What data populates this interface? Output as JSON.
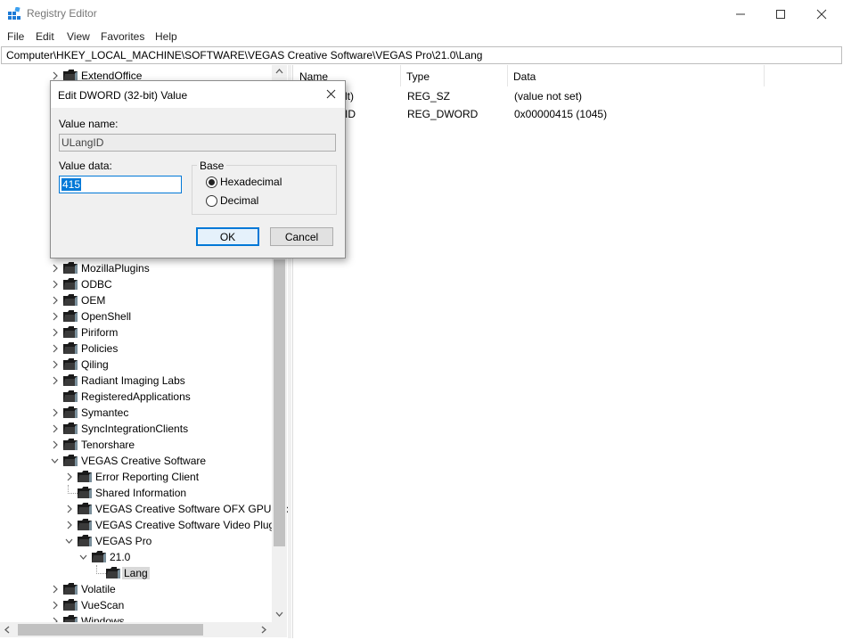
{
  "window": {
    "title": "Registry Editor"
  },
  "menu": [
    "File",
    "Edit",
    "View",
    "Favorites",
    "Help"
  ],
  "address": "Computer\\HKEY_LOCAL_MACHINE\\SOFTWARE\\VEGAS Creative Software\\VEGAS Pro\\21.0\\Lang",
  "tree": {
    "items": [
      {
        "label": "ExtendOffice",
        "level": 1,
        "expander": "collapsed",
        "selected": false
      },
      {
        "label": "MozillaPlugins",
        "level": 1,
        "expander": "collapsed",
        "selected": false
      },
      {
        "label": "ODBC",
        "level": 1,
        "expander": "collapsed",
        "selected": false
      },
      {
        "label": "OEM",
        "level": 1,
        "expander": "collapsed",
        "selected": false
      },
      {
        "label": "OpenShell",
        "level": 1,
        "expander": "collapsed",
        "selected": false
      },
      {
        "label": "Piriform",
        "level": 1,
        "expander": "collapsed",
        "selected": false
      },
      {
        "label": "Policies",
        "level": 1,
        "expander": "collapsed",
        "selected": false
      },
      {
        "label": "Qiling",
        "level": 1,
        "expander": "collapsed",
        "selected": false
      },
      {
        "label": "Radiant Imaging Labs",
        "level": 1,
        "expander": "collapsed",
        "selected": false
      },
      {
        "label": "RegisteredApplications",
        "level": 1,
        "expander": "none",
        "selected": false
      },
      {
        "label": "Symantec",
        "level": 1,
        "expander": "collapsed",
        "selected": false
      },
      {
        "label": "SyncIntegrationClients",
        "level": 1,
        "expander": "collapsed",
        "selected": false
      },
      {
        "label": "Tenorshare",
        "level": 1,
        "expander": "collapsed",
        "selected": false
      },
      {
        "label": "VEGAS Creative Software",
        "level": 1,
        "expander": "expanded",
        "selected": false
      },
      {
        "label": "Error Reporting Client",
        "level": 2,
        "expander": "collapsed",
        "selected": false
      },
      {
        "label": "Shared Information",
        "level": 2,
        "expander": "none",
        "selected": false
      },
      {
        "label": "VEGAS Creative Software OFX GPU Vic",
        "level": 2,
        "expander": "collapsed",
        "selected": false
      },
      {
        "label": "VEGAS Creative Software Video Plug-I",
        "level": 2,
        "expander": "collapsed",
        "selected": false
      },
      {
        "label": "VEGAS Pro",
        "level": 2,
        "expander": "expanded",
        "selected": false
      },
      {
        "label": "21.0",
        "level": 3,
        "expander": "expanded",
        "selected": false
      },
      {
        "label": "Lang",
        "level": 4,
        "expander": "none",
        "selected": true
      },
      {
        "label": "Volatile",
        "level": 1,
        "expander": "collapsed",
        "selected": false
      },
      {
        "label": "VueScan",
        "level": 1,
        "expander": "collapsed",
        "selected": false
      },
      {
        "label": "Windows",
        "level": 1,
        "expander": "collapsed",
        "selected": false
      }
    ]
  },
  "list": {
    "columns": [
      "Name",
      "Type",
      "Data"
    ],
    "rows": [
      {
        "name": "(Default)",
        "name_visible": "lt)",
        "type": "REG_SZ",
        "data": "(value not set)"
      },
      {
        "name": "ULangID",
        "name_visible": "ID",
        "type": "REG_DWORD",
        "data": "0x00000415 (1045)"
      }
    ]
  },
  "dialog": {
    "title": "Edit DWORD (32-bit) Value",
    "value_name_label": "Value name:",
    "value_name": "ULangID",
    "value_data_label": "Value data:",
    "value_data": "415",
    "base_label": "Base",
    "base_options": [
      {
        "label": "Hexadecimal",
        "checked": true
      },
      {
        "label": "Decimal",
        "checked": false
      }
    ],
    "ok_label": "OK",
    "cancel_label": "Cancel"
  },
  "colors": {
    "folder": "#1a1a1a",
    "selection": "#0078d7",
    "dialog_bg": "#f0f0f0"
  },
  "icons": [
    "registry-app-icon",
    "minimize-icon",
    "maximize-icon",
    "close-icon",
    "folder-icon",
    "chevron-right-icon",
    "chevron-down-icon",
    "scroll-up-icon",
    "scroll-down-icon",
    "scroll-left-icon",
    "scroll-right-icon"
  ]
}
